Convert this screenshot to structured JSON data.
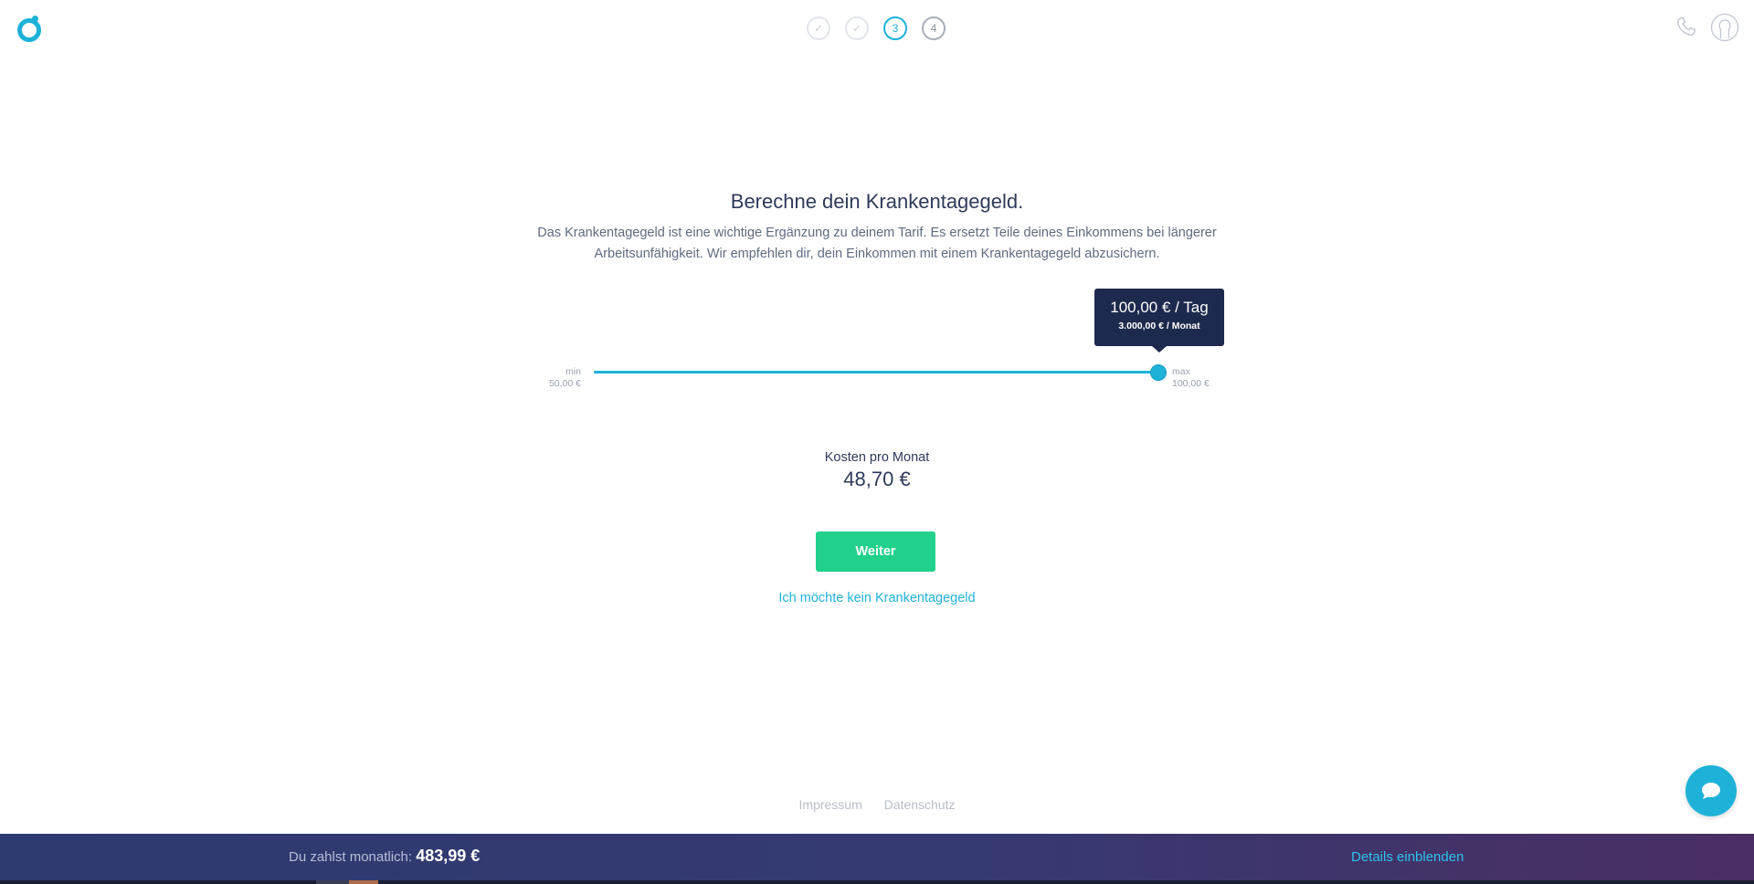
{
  "header": {
    "steps": [
      {
        "label": "✓",
        "state": "done"
      },
      {
        "label": "✓",
        "state": "done"
      },
      {
        "label": "3",
        "state": "active"
      },
      {
        "label": "4",
        "state": "future"
      }
    ],
    "icons": [
      "phone-icon",
      "user-icon"
    ]
  },
  "main": {
    "title": "Berechne dein Krankentagegeld.",
    "description_line1": "Das Krankentagegeld ist eine wichtige Ergänzung zu deinem Tarif. Es ersetzt Teile deines Einkommens bei längerer",
    "description_line2": "Arbeitsunfähigkeit. Wir empfehlen dir, dein Einkommen mit einem Krankentagegeld abzusichern."
  },
  "slider": {
    "min_label": "min",
    "min_value": "50,00 €",
    "max_label": "max",
    "max_value": "100,00 €",
    "value_fraction": 1.0,
    "tooltip_day": "100,00 € / Tag",
    "tooltip_month": "3.000,00 € / Monat"
  },
  "cost": {
    "label": "Kosten pro Monat",
    "value": "48,70 €"
  },
  "actions": {
    "continue_label": "Weiter",
    "decline_label": "Ich möchte kein Krankentagegeld"
  },
  "footer": {
    "impressum": "Impressum",
    "datenschutz": "Datenschutz"
  },
  "bottom_bar": {
    "pay_label": "Du zahlst monatlich:",
    "pay_value": "483,99 €",
    "details_label": "Details einblenden"
  },
  "colors": {
    "accent": "#1fb2d8",
    "button": "#21d18b",
    "tooltip_bg": "#1e2a4d",
    "bar_start": "#2d3a6f",
    "bar_end": "#4a2e63"
  }
}
